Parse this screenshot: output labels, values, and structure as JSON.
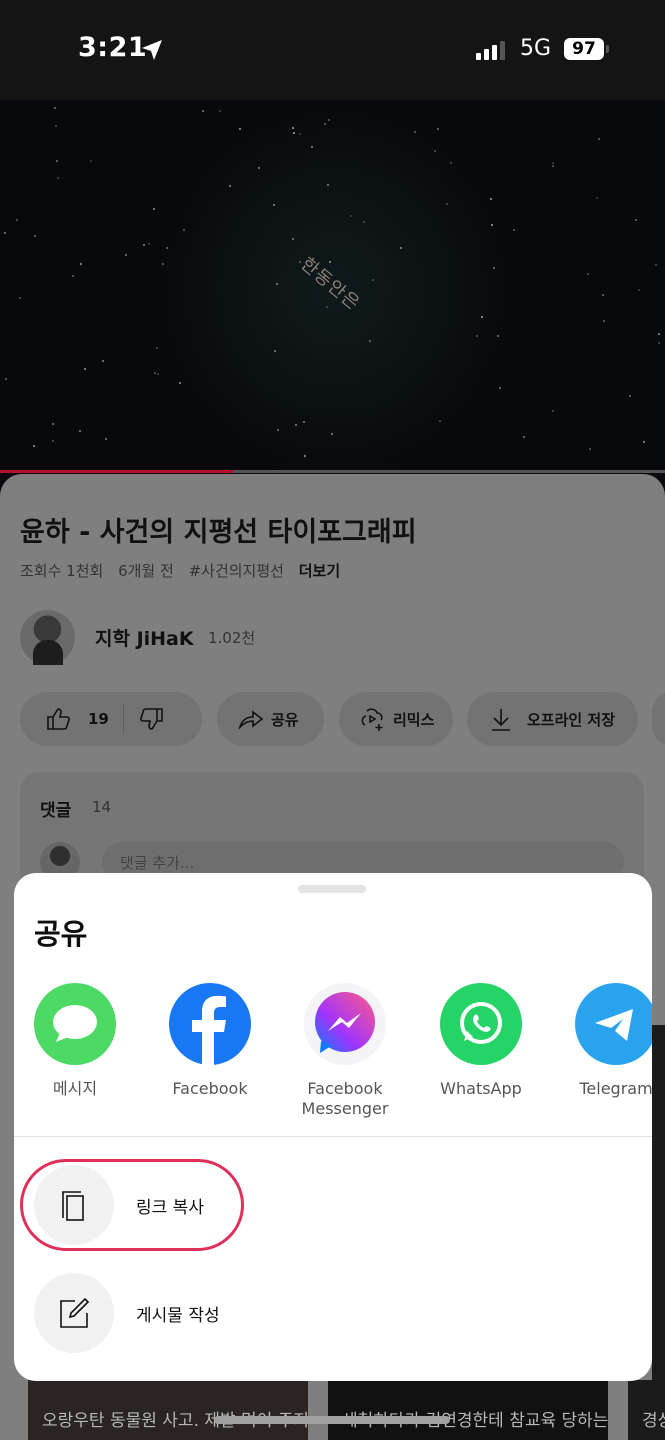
{
  "status_bar": {
    "time": "3:21",
    "network": "5G",
    "battery": "97"
  },
  "video": {
    "overlay_text": "한동안은",
    "progress_percent": 35
  },
  "video_info": {
    "title": "윤하 - 사건의 지평선 타이포그래피",
    "views": "조회수 1천회",
    "age": "6개월 전",
    "hashtag": "#사건의지평선",
    "more": "더보기"
  },
  "channel": {
    "name": "지학 JiHaK",
    "subscribers": "1.02천"
  },
  "actions": {
    "like_count": "19",
    "share": "공유",
    "remix": "리믹스",
    "download": "오프라인 저장"
  },
  "comments": {
    "title": "댓글",
    "count": "14",
    "placeholder": "댓글 추가..."
  },
  "recommendations": [
    {
      "title": "오랑우탄 동물원 사고. 제발 먹이 주지 마세요"
    },
    {
      "title": "세척하다가 김연경한테 참교육 당하는 제시"
    },
    {
      "title": "경상 타"
    }
  ],
  "share_sheet": {
    "title": "공유",
    "apps": [
      {
        "label": "메시지",
        "icon": "messages-icon",
        "color": "#4cd964"
      },
      {
        "label": "Facebook",
        "icon": "facebook-icon",
        "color": "#1877f2"
      },
      {
        "label": "Facebook Messenger",
        "icon": "messenger-icon",
        "color": "#a334fa"
      },
      {
        "label": "WhatsApp",
        "icon": "whatsapp-icon",
        "color": "#25d366"
      },
      {
        "label": "Telegram",
        "icon": "telegram-icon",
        "color": "#2aa3ef"
      }
    ],
    "options": [
      {
        "label": "링크 복사",
        "icon": "copy-icon"
      },
      {
        "label": "게시물 작성",
        "icon": "compose-icon"
      }
    ],
    "highlight_color": "#e0305a"
  }
}
